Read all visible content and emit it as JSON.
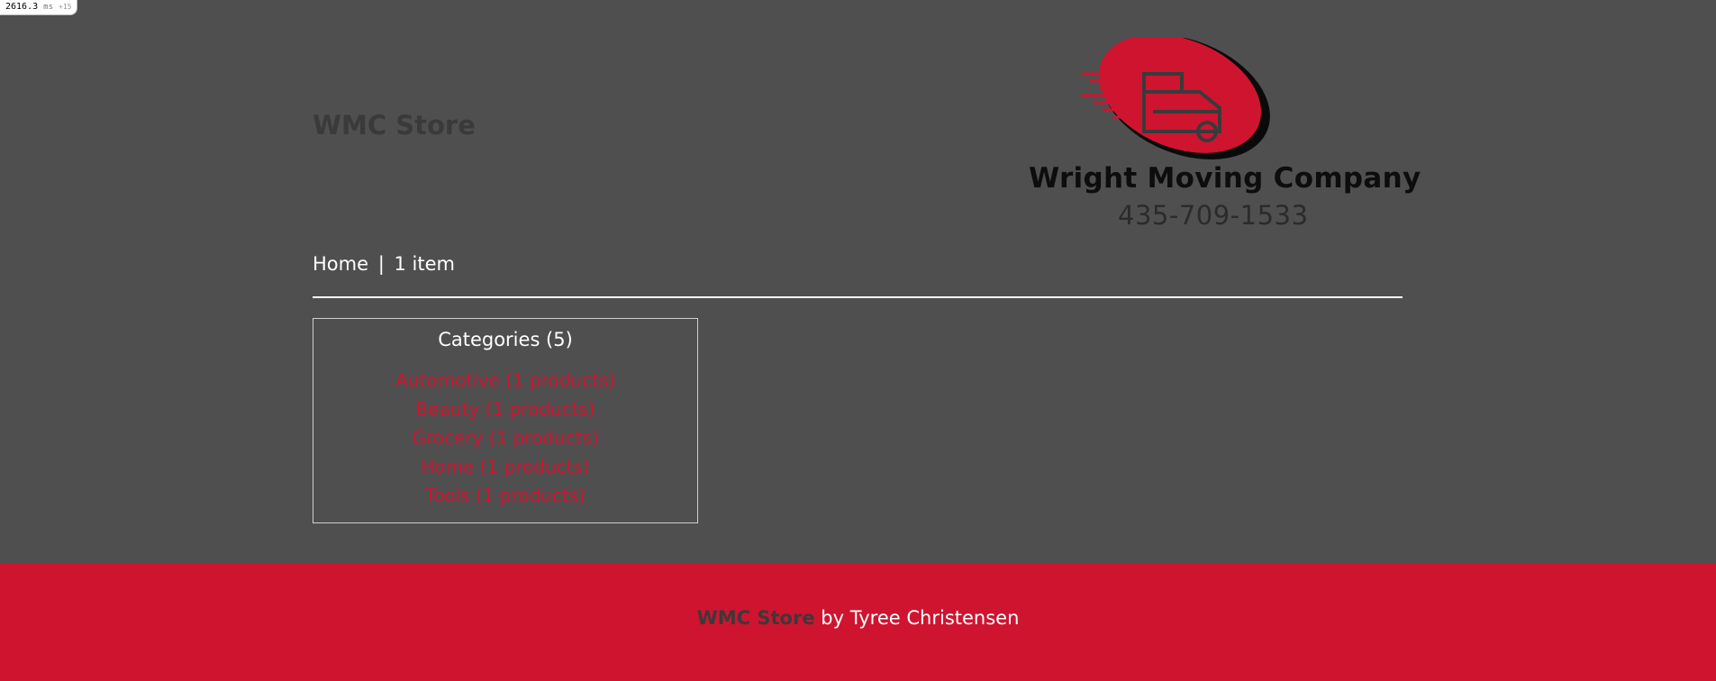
{
  "perf": {
    "value": "2616.3",
    "unit": "ms",
    "extra": "+15"
  },
  "header": {
    "site_title": "WMC Store",
    "logo_company": "Wright Moving Company",
    "logo_phone": "435-709-1533"
  },
  "nav": {
    "home_label": "Home",
    "separator": "|",
    "cart_label": "1 item"
  },
  "categories": {
    "title": "Categories (5)",
    "items": [
      {
        "label": "Automotive (1 products)"
      },
      {
        "label": "Beauty (1 products)"
      },
      {
        "label": "Grocery (1 products)"
      },
      {
        "label": "Home (1 products)"
      },
      {
        "label": "Tools (1 products)"
      }
    ]
  },
  "footer": {
    "brand": "WMC Store",
    "suffix": " by Tyree Christensen"
  },
  "colors": {
    "background": "#4f4f4f",
    "accent": "#cf1430",
    "text": "#ffffff",
    "muted_text": "#3a3a3a"
  }
}
